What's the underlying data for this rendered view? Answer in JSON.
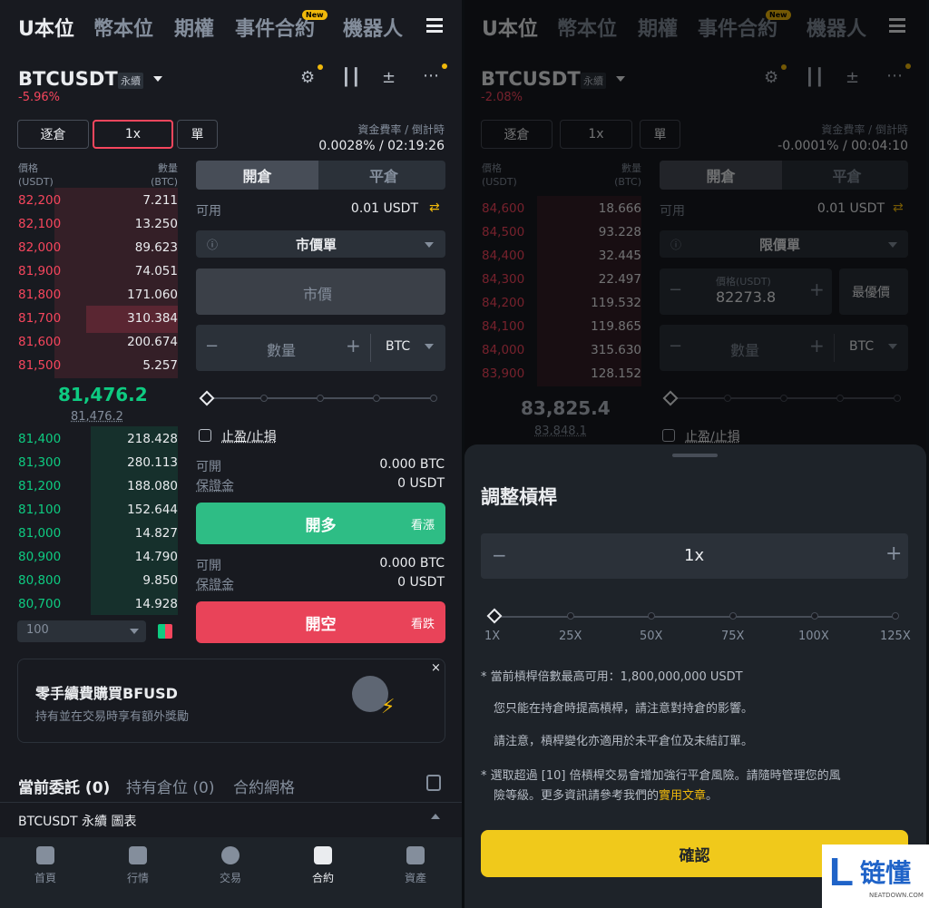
{
  "nav_tabs": [
    "U本位",
    "幣本位",
    "期權",
    "事件合約",
    "機器人"
  ],
  "new_badge": "New",
  "left": {
    "symbol": "BTCUSDT",
    "perp_tag": "永續",
    "change": "-5.96%",
    "margin_mode": "逐倉",
    "leverage": "1x",
    "position_mode": "單",
    "funding_label": "資金費率 / 倒計時",
    "funding_value": "0.0028% / 02:19:26",
    "ob_price_head": "價格",
    "ob_price_unit": "(USDT)",
    "ob_qty_head": "數量",
    "ob_qty_unit": "(BTC)",
    "asks": [
      {
        "price": "82,200",
        "qty": "7.211"
      },
      {
        "price": "82,100",
        "qty": "13.250"
      },
      {
        "price": "82,000",
        "qty": "89.623"
      },
      {
        "price": "81,900",
        "qty": "74.051"
      },
      {
        "price": "81,800",
        "qty": "171.060"
      },
      {
        "price": "81,700",
        "qty": "310.384"
      },
      {
        "price": "81,600",
        "qty": "200.674"
      },
      {
        "price": "81,500",
        "qty": "5.257"
      }
    ],
    "last_price": "81,476.2",
    "mark_price": "81,476.2",
    "bids": [
      {
        "price": "81,400",
        "qty": "218.428"
      },
      {
        "price": "81,300",
        "qty": "280.113"
      },
      {
        "price": "81,200",
        "qty": "188.080"
      },
      {
        "price": "81,100",
        "qty": "152.644"
      },
      {
        "price": "81,000",
        "qty": "14.827"
      },
      {
        "price": "80,900",
        "qty": "14.790"
      },
      {
        "price": "80,800",
        "qty": "9.850"
      },
      {
        "price": "80,700",
        "qty": "14.928"
      }
    ],
    "depth_select": "100",
    "open_tab": "開倉",
    "close_tab": "平倉",
    "avail_label": "可用",
    "avail_value": "0.01 USDT",
    "order_type": "市價單",
    "market_price_field": "市價",
    "qty_placeholder": "數量",
    "qty_unit": "BTC",
    "tpsl_label": "止盈/止損",
    "can_open_label": "可開",
    "can_open_value": "0.000 BTC",
    "margin_label": "保證金",
    "margin_value": "0 USDT",
    "buy_label": "開多",
    "buy_sub": "看漲",
    "sell_label": "開空",
    "sell_sub": "看跌",
    "promo_title": "零手續費購買BFUSD",
    "promo_sub": "持有並在交易時享有額外獎勵",
    "orders_tabs": [
      "當前委託 (0)",
      "持有倉位 (0)",
      "合約網格"
    ],
    "chart_bar": "BTCUSDT 永續  圖表",
    "bottom_nav": [
      "首頁",
      "行情",
      "交易",
      "合約",
      "資產"
    ]
  },
  "right": {
    "symbol": "BTCUSDT",
    "perp_tag": "永續",
    "change": "-2.08%",
    "margin_mode": "逐倉",
    "leverage": "1x",
    "position_mode": "單",
    "funding_label": "資金費率 / 倒計時",
    "funding_value": "-0.0001% / 00:04:10",
    "ob_price_head": "價格",
    "ob_price_unit": "(USDT)",
    "ob_qty_head": "數量",
    "ob_qty_unit": "(BTC)",
    "asks": [
      {
        "price": "84,600",
        "qty": "18.666"
      },
      {
        "price": "84,500",
        "qty": "93.228"
      },
      {
        "price": "84,400",
        "qty": "32.445"
      },
      {
        "price": "84,300",
        "qty": "22.497"
      },
      {
        "price": "84,200",
        "qty": "119.532"
      },
      {
        "price": "84,100",
        "qty": "119.865"
      },
      {
        "price": "84,000",
        "qty": "315.630"
      },
      {
        "price": "83,900",
        "qty": "128.152"
      }
    ],
    "last_price": "83,825.4",
    "mark_price": "83,848.1",
    "open_tab": "開倉",
    "close_tab": "平倉",
    "avail_label": "可用",
    "avail_value": "0.01 USDT",
    "order_type": "限價單",
    "price_label": "價格(USDT)",
    "price_value": "82273.8",
    "best_price": "最優價",
    "qty_placeholder": "數量",
    "qty_unit": "BTC",
    "tpsl_label": "止盈/止損",
    "sheet_title": "調整槓桿",
    "sheet_leverage": "1x",
    "sheet_minus": "−",
    "sheet_plus": "+",
    "ticks": [
      "1X",
      "25X",
      "50X",
      "75X",
      "100X",
      "125X"
    ],
    "note1": "* 當前槓桿倍數最高可用：1,800,000,000 USDT",
    "note2": "您只能在持倉時提高槓桿，請注意對持倉的影響。",
    "note3": "請注意，槓桿變化亦適用於未平倉位及未結訂單。",
    "note4a": "* 選取超過 [10] 倍槓桿交易會增加強行平倉風險。請隨時管理您的風",
    "note4b": "險等級。更多資訊請參考我們的",
    "note4link": "實用文章",
    "note4end": "。",
    "confirm": "確認"
  },
  "watermark": {
    "text": "链懂",
    "sub": "NEATDOWN.COM",
    "letter": "L"
  }
}
